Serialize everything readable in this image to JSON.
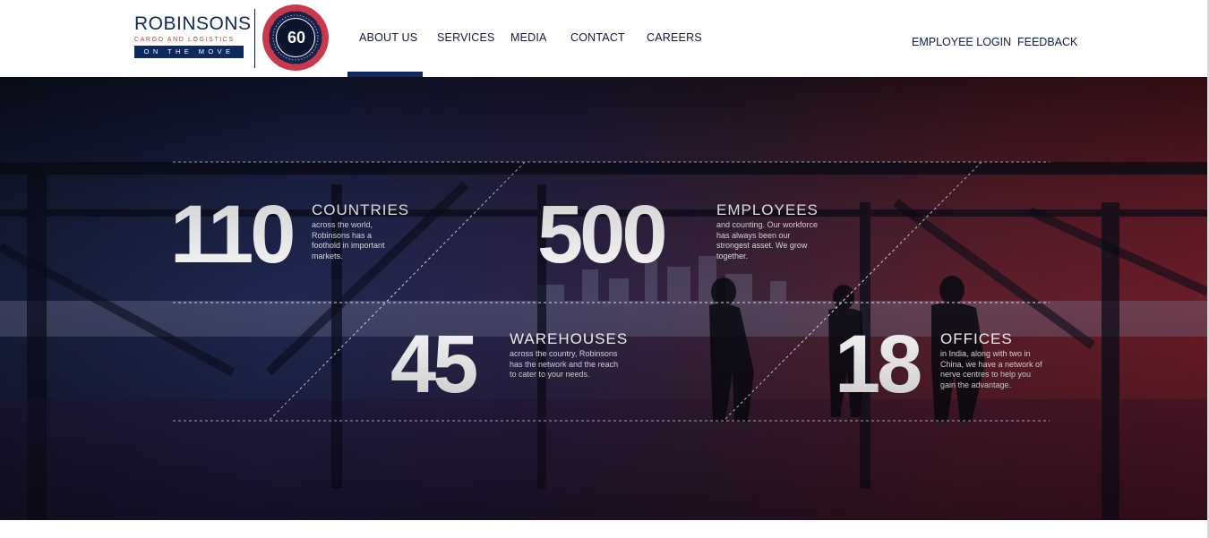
{
  "brand": {
    "name": "ROBINSONS",
    "tagline": "CARGO AND LOGISTICS",
    "motto": "ON THE MOVE",
    "anniversary_number": "60"
  },
  "nav": {
    "items": [
      {
        "label": "ABOUT US"
      },
      {
        "label": "SERVICES"
      },
      {
        "label": "MEDIA"
      },
      {
        "label": "CONTACT"
      },
      {
        "label": "CAREERS"
      }
    ],
    "active": "ABOUT US"
  },
  "utility": {
    "employee_login": "EMPLOYEE LOGIN",
    "feedback": "FEEDBACK"
  },
  "stats": [
    {
      "number": "110",
      "title": "COUNTRIES",
      "description": "across the world, Robinsons has a foothold in important markets."
    },
    {
      "number": "500",
      "title": "EMPLOYEES",
      "description": "and counting. Our workforce has always been our strongest asset. We grow together."
    },
    {
      "number": "45",
      "title": "WAREHOUSES",
      "description": "across the country, Robinsons has the network and the reach to cater to your needs."
    },
    {
      "number": "18",
      "title": "OFFICES",
      "description": "in India, along with two in China, we have a network of nerve centres to help you gain the advantage."
    }
  ],
  "colors": {
    "brand_navy": "#0e2a5c",
    "brand_red": "#c0392b",
    "hero_left": "#1f2750",
    "hero_right": "#6e1c27"
  }
}
